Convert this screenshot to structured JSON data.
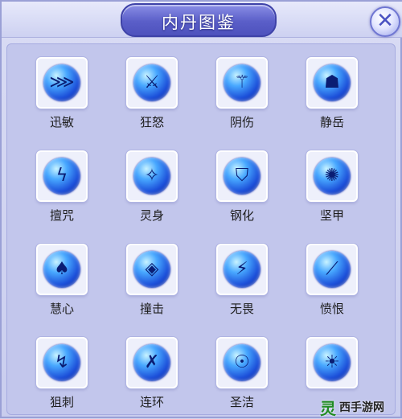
{
  "window": {
    "title": "内丹图鉴"
  },
  "items": [
    {
      "label": "迅敏",
      "icon": "swift-claw-icon",
      "glyph": "⋙"
    },
    {
      "label": "狂怒",
      "icon": "rage-sword-icon",
      "glyph": "⚔"
    },
    {
      "label": "阴伤",
      "icon": "shadow-strike-icon",
      "glyph": "⚚"
    },
    {
      "label": "静岳",
      "icon": "mountain-statue-icon",
      "glyph": "☗"
    },
    {
      "label": "擅咒",
      "icon": "lightning-curse-icon",
      "glyph": "ϟ"
    },
    {
      "label": "灵身",
      "icon": "spirit-body-icon",
      "glyph": "✧"
    },
    {
      "label": "钢化",
      "icon": "steel-shield-icon",
      "glyph": "⛉"
    },
    {
      "label": "坚甲",
      "icon": "armor-beast-icon",
      "glyph": "✺"
    },
    {
      "label": "慧心",
      "icon": "wisdom-heart-icon",
      "glyph": "♠"
    },
    {
      "label": "撞击",
      "icon": "impact-diamond-icon",
      "glyph": "◈"
    },
    {
      "label": "无畏",
      "icon": "fearless-blade-icon",
      "glyph": "⚡"
    },
    {
      "label": "愤恨",
      "icon": "fury-slash-icon",
      "glyph": "⟋"
    },
    {
      "label": "狙刺",
      "icon": "snipe-bolt-icon",
      "glyph": "↯"
    },
    {
      "label": "连环",
      "icon": "chain-swords-icon",
      "glyph": "✗"
    },
    {
      "label": "圣洁",
      "icon": "holy-skull-icon",
      "glyph": "☉"
    },
    {
      "label": "",
      "icon": "radiant-idol-icon",
      "glyph": "☀"
    }
  ],
  "watermark": {
    "ling": "灵",
    "rest": "西手游网"
  }
}
